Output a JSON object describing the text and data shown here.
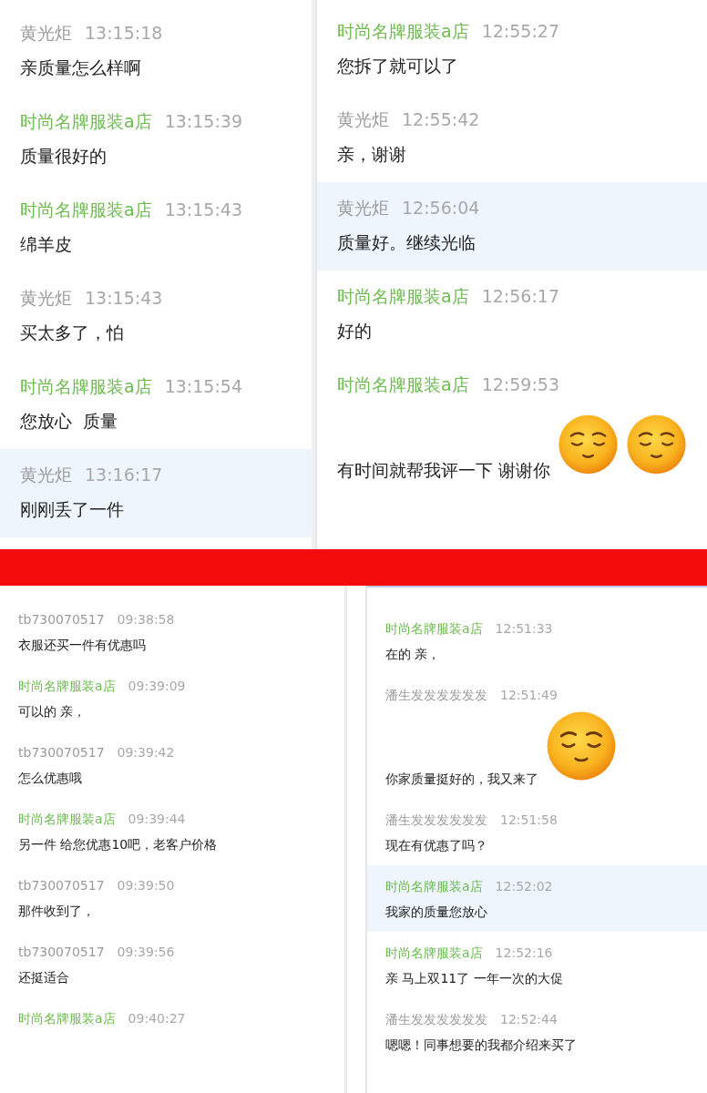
{
  "panels": [
    {
      "messages": [
        {
          "kind": "customer",
          "name": "黄光炬",
          "time": "13:15:18",
          "text": "亲质量怎么样啊",
          "selected": false
        },
        {
          "kind": "shop",
          "name": "时尚名牌服装a店",
          "time": "13:15:39",
          "text": "质量很好的",
          "selected": false
        },
        {
          "kind": "shop",
          "name": "时尚名牌服装a店",
          "time": "13:15:43",
          "text": "绵羊皮",
          "selected": false
        },
        {
          "kind": "customer",
          "name": "黄光炬",
          "time": "13:15:43",
          "text": "买太多了，怕",
          "selected": false
        },
        {
          "kind": "shop",
          "name": "时尚名牌服装a店",
          "time": "13:15:54",
          "text": "您放心  质量",
          "selected": false
        },
        {
          "kind": "customer",
          "name": "黄光炬",
          "time": "13:16:17",
          "text": "刚刚丢了一件",
          "selected": true
        }
      ]
    },
    {
      "messages": [
        {
          "kind": "shop",
          "name": "时尚名牌服装a店",
          "time": "12:55:27",
          "text": "您拆了就可以了",
          "selected": false
        },
        {
          "kind": "customer",
          "name": "黄光炬",
          "time": "12:55:42",
          "text": "亲，谢谢",
          "selected": false
        },
        {
          "kind": "customer",
          "name": "黄光炬",
          "time": "12:56:04",
          "text": "质量好。继续光临",
          "selected": true
        },
        {
          "kind": "shop",
          "name": "时尚名牌服装a店",
          "time": "12:56:17",
          "text": "好的",
          "selected": false
        },
        {
          "kind": "shop",
          "name": "时尚名牌服装a店",
          "time": "12:59:53",
          "text": "有时间就帮我评一下 谢谢你",
          "selected": false,
          "emojis": [
            {
              "kind": "smiley"
            },
            {
              "kind": "smiley"
            }
          ]
        }
      ]
    },
    {
      "messages": [
        {
          "kind": "customer",
          "name": "tb730070517",
          "time": "09:38:58",
          "text": "衣服还买一件有优惠吗",
          "selected": false
        },
        {
          "kind": "shop",
          "name": "时尚名牌服装a店",
          "time": "09:39:09",
          "text": "可以的 亲，",
          "selected": false
        },
        {
          "kind": "customer",
          "name": "tb730070517",
          "time": "09:39:42",
          "text": "怎么优惠哦",
          "selected": false
        },
        {
          "kind": "shop",
          "name": "时尚名牌服装a店",
          "time": "09:39:44",
          "text": "另一件 给您优惠10吧，老客户价格",
          "selected": false
        },
        {
          "kind": "customer",
          "name": "tb730070517",
          "time": "09:39:50",
          "text": "那件收到了，",
          "selected": false
        },
        {
          "kind": "customer",
          "name": "tb730070517",
          "time": "09:39:56",
          "text": "还挺适合",
          "selected": false
        },
        {
          "kind": "shop",
          "name": "时尚名牌服装a店",
          "time": "09:40:27",
          "selected": false
        }
      ]
    },
    {
      "messages": [
        {
          "kind": "shop",
          "name": "时尚名牌服装a店",
          "time": "12:51:33",
          "text": "在的 亲，",
          "selected": false
        },
        {
          "kind": "customer",
          "name": "潘生发发发发发发",
          "time": "12:51:49",
          "text": "你家质量挺好的，我又来了",
          "selected": false,
          "emojis": [
            {
              "kind": "smiley"
            }
          ]
        },
        {
          "kind": "customer",
          "name": "潘生发发发发发发",
          "time": "12:51:58",
          "text": "现在有优惠了吗？",
          "selected": false
        },
        {
          "kind": "shop",
          "name": "时尚名牌服装a店",
          "time": "12:52:02",
          "text": "我家的质量您放心",
          "selected": true
        },
        {
          "kind": "shop",
          "name": "时尚名牌服装a店",
          "time": "12:52:16",
          "text": "亲 马上双11了 一年一次的大促",
          "selected": false
        },
        {
          "kind": "customer",
          "name": "潘生发发发发发发",
          "time": "12:52:44",
          "text": "嗯嗯！同事想要的我都介绍来买了",
          "selected": false
        }
      ]
    }
  ]
}
